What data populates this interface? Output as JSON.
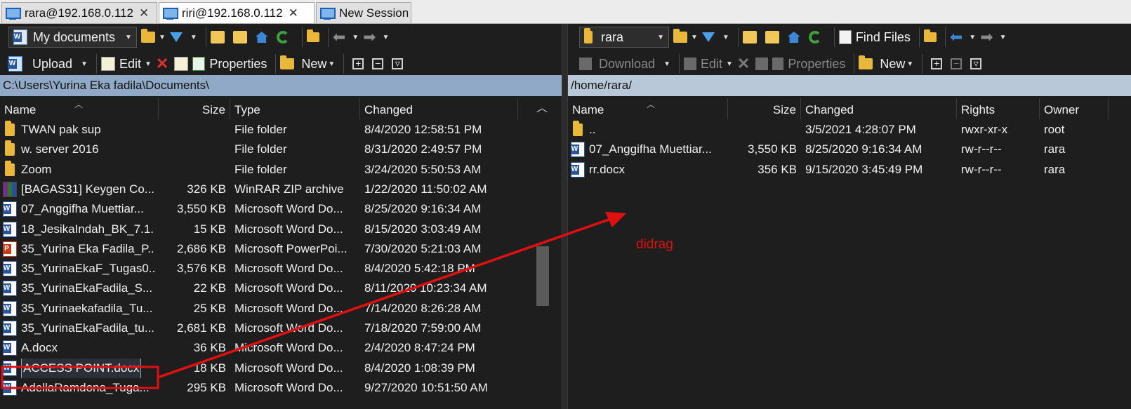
{
  "tabs": [
    {
      "label": "rara@192.168.0.112",
      "active": false
    },
    {
      "label": "riri@192.168.0.112",
      "active": true
    },
    {
      "label": "New Session",
      "active": false
    }
  ],
  "left": {
    "location_combo": "My documents",
    "toolbar": {
      "upload": "Upload",
      "edit": "Edit",
      "properties": "Properties",
      "new": "New"
    },
    "path": "C:\\Users\\Yurina Eka fadila\\Documents\\",
    "columns": [
      "Name",
      "Size",
      "Type",
      "Changed"
    ],
    "files": [
      {
        "name": "TWAN pak sup",
        "size": "",
        "type": "File folder",
        "changed": "8/4/2020  12:58:51 PM",
        "icon": "folder"
      },
      {
        "name": "w. server 2016",
        "size": "",
        "type": "File folder",
        "changed": "8/31/2020  2:49:57 PM",
        "icon": "folder"
      },
      {
        "name": "Zoom",
        "size": "",
        "type": "File folder",
        "changed": "3/24/2020  5:50:53 AM",
        "icon": "folder"
      },
      {
        "name": "[BAGAS31] Keygen Co...",
        "size": "326 KB",
        "type": "WinRAR ZIP archive",
        "changed": "1/22/2020  11:50:02 AM",
        "icon": "rar"
      },
      {
        "name": "07_Anggifha Muettiar...",
        "size": "3,550 KB",
        "type": "Microsoft Word Do...",
        "changed": "8/25/2020  9:16:34 AM",
        "icon": "word"
      },
      {
        "name": "18_JesikaIndah_BK_7.1....",
        "size": "15 KB",
        "type": "Microsoft Word Do...",
        "changed": "8/15/2020  3:03:49 AM",
        "icon": "word"
      },
      {
        "name": "35_Yurina Eka Fadila_P...",
        "size": "2,686 KB",
        "type": "Microsoft PowerPoi...",
        "changed": "7/30/2020  5:21:03 AM",
        "icon": "ppt"
      },
      {
        "name": "35_YurinaEkaF_Tugas0...",
        "size": "3,576 KB",
        "type": "Microsoft Word Do...",
        "changed": "8/4/2020  5:42:18 PM",
        "icon": "word"
      },
      {
        "name": "35_YurinaEkaFadila_S...",
        "size": "22 KB",
        "type": "Microsoft Word Do...",
        "changed": "8/11/2020  10:23:34 AM",
        "icon": "word"
      },
      {
        "name": "35_Yurinaekafadila_Tu...",
        "size": "25 KB",
        "type": "Microsoft Word Do...",
        "changed": "7/14/2020  8:26:28 AM",
        "icon": "word"
      },
      {
        "name": "35_YurinaEkaFadila_tu...",
        "size": "2,681 KB",
        "type": "Microsoft Word Do...",
        "changed": "7/18/2020  7:59:00 AM",
        "icon": "word"
      },
      {
        "name": "A.docx",
        "size": "36 KB",
        "type": "Microsoft Word Do...",
        "changed": "2/4/2020  8:47:24 PM",
        "icon": "word"
      },
      {
        "name": "ACCESS POINT.docx",
        "size": "18 KB",
        "type": "Microsoft Word Do...",
        "changed": "8/4/2020  1:08:39 PM",
        "icon": "word",
        "selected": true
      },
      {
        "name": "AdellaRamdona_Tuga...",
        "size": "295 KB",
        "type": "Microsoft Word Do...",
        "changed": "9/27/2020  10:51:50 AM",
        "icon": "word"
      }
    ]
  },
  "right": {
    "location_combo": "rara",
    "find_files": "Find Files",
    "toolbar": {
      "download": "Download",
      "edit": "Edit",
      "properties": "Properties",
      "new": "New"
    },
    "path": "/home/rara/",
    "columns": [
      "Name",
      "Size",
      "Changed",
      "Rights",
      "Owner"
    ],
    "files": [
      {
        "name": "..",
        "size": "",
        "changed": "3/5/2021 4:28:07 PM",
        "rights": "rwxr-xr-x",
        "owner": "root",
        "icon": "up"
      },
      {
        "name": "07_Anggifha Muettiar...",
        "size": "3,550 KB",
        "changed": "8/25/2020 9:16:34 AM",
        "rights": "rw-r--r--",
        "owner": "rara",
        "icon": "word"
      },
      {
        "name": "rr.docx",
        "size": "356 KB",
        "changed": "9/15/2020 3:45:49 PM",
        "rights": "rw-r--r--",
        "owner": "rara",
        "icon": "word"
      }
    ]
  },
  "annotation": {
    "label": "didrag",
    "color": "#e01010"
  }
}
